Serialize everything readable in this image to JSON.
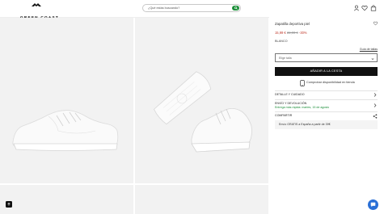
{
  "header": {
    "brand": "GREEN COAST",
    "search_placeholder": "¿Qué estás buscando?",
    "icons": [
      "logo-icon",
      "search-icon",
      "user-icon",
      "heart-icon",
      "bag-icon"
    ]
  },
  "product": {
    "title": "Zapatilla deportiva piel",
    "price_now": "15,99 €",
    "price_old": "22,99 €",
    "discount": "-30%",
    "color": "BLANCO",
    "size_guide": "Guía de tallas",
    "size_placeholder": "Elige talla",
    "add_to_cart": "AÑADIR A LA CESTA",
    "store_availability": "Comprobar disponibilidad en tienda"
  },
  "sections": [
    {
      "title": "DETALLE Y CUIDADO"
    },
    {
      "title": "ENVÍO Y DEVOLUCIÓN",
      "subtitle": "Entrega más rápida: martes, 15 de agosto"
    },
    {
      "title": "COMPARTIR"
    }
  ],
  "shipping_info": "Envío GRATIS a España a partir de 39€",
  "colors": {
    "accent_green": "#1d8f3a",
    "sale_red": "#c0392b",
    "button_black": "#111111",
    "chat_blue": "#2a6fd6"
  }
}
